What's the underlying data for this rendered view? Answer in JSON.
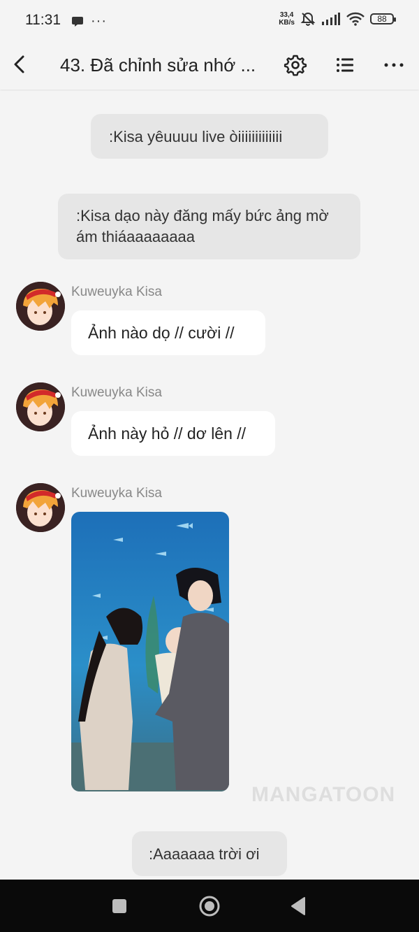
{
  "status_bar": {
    "time": "11:31",
    "more": "···",
    "net_speed_value": "33,4",
    "net_speed_unit": "KB/s",
    "battery": "88"
  },
  "toolbar": {
    "title": "43. Đã chỉnh sửa nhớ ..."
  },
  "chat": {
    "narration_1": ":Kisa yêuuuu live òiiiiiiiiiiiii",
    "narration_2": ":Kisa dạo này đăng mấy bức ảng mờ ám thiáaaaaaaaa",
    "messages": [
      {
        "sender": "Kuweuyka Kisa",
        "text": "Ảnh nào dọ // cười //"
      },
      {
        "sender": "Kuweuyka Kisa",
        "text": "Ảnh này hỏ // dơ lên //"
      },
      {
        "sender": "Kuweuyka Kisa",
        "text": ""
      }
    ],
    "narration_3": ":Aaaaaaa trời ơi",
    "watermark": "MANGATOON"
  },
  "colors": {
    "background": "#f4f4f4",
    "narration_bg": "#e6e6e6",
    "bubble_bg": "#ffffff",
    "sender_text": "#888888",
    "nav_bar": "#0a0a0a"
  }
}
